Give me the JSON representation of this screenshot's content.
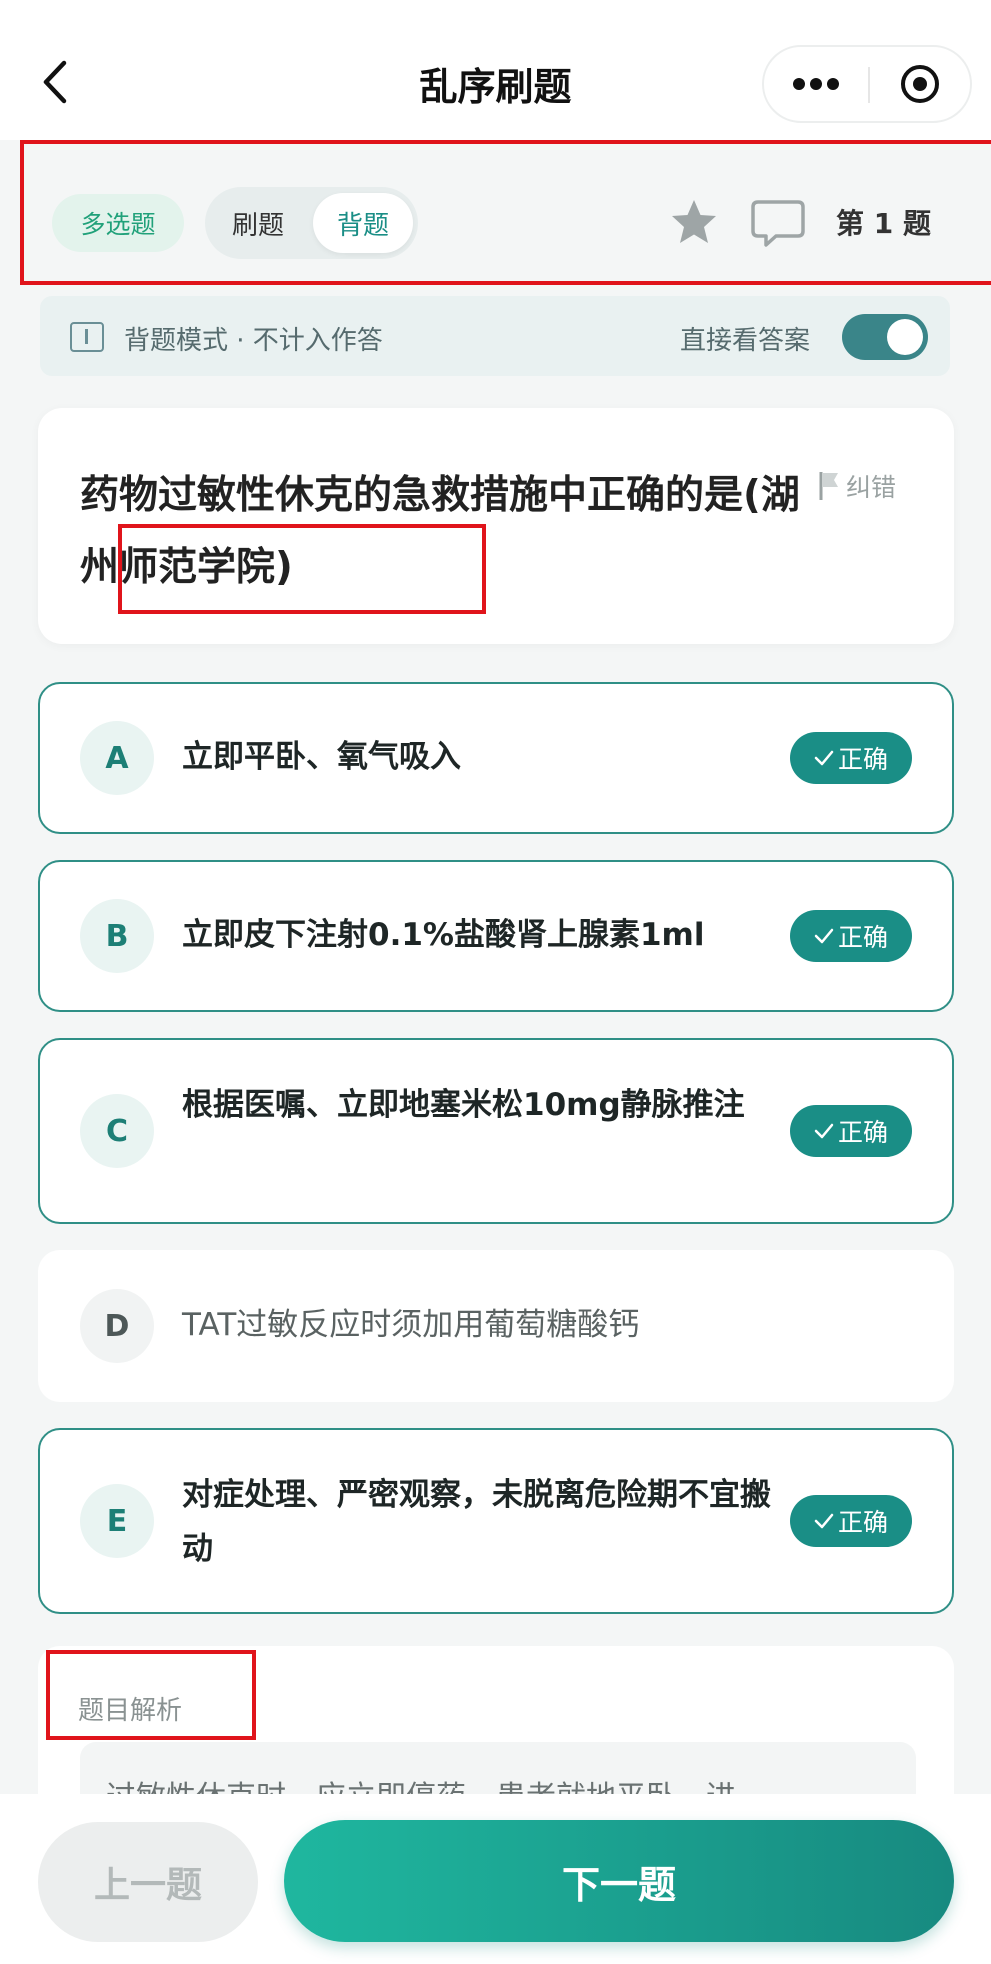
{
  "nav": {
    "title": "乱序刷题",
    "back_icon": "chevron-left-icon",
    "more_icon": "more-dots-icon",
    "target_icon": "target-icon"
  },
  "mode": {
    "type_badge": "多选题",
    "options": [
      "刷题",
      "背题"
    ],
    "selected": "背题",
    "question_number": "第 1 题"
  },
  "banner": {
    "text": "背题模式 · 不计入作答",
    "toggle_label": "直接看答案",
    "toggle_on": true
  },
  "question": {
    "text": "药物过敏性休克的急救措施中正确的是(湖州师范学院)",
    "report_label": "纠错"
  },
  "options": [
    {
      "letter": "A",
      "text": "立即平卧、氧气吸入",
      "correct": true,
      "badge": "正确"
    },
    {
      "letter": "B",
      "text": "立即皮下注射0.1%盐酸肾上腺素1ml",
      "correct": true,
      "badge": "正确"
    },
    {
      "letter": "C",
      "text": "根据医嘱、立即地塞米松10mg静脉推注",
      "correct": true,
      "badge": "正确"
    },
    {
      "letter": "D",
      "text": "TAT过敏反应时须加用葡萄糖酸钙",
      "correct": false,
      "badge": ""
    },
    {
      "letter": "E",
      "text": "对症处理、严密观察，未脱离危险期不宜搬动",
      "correct": true,
      "badge": "正确"
    }
  ],
  "analysis": {
    "label": "题目解析",
    "text": "过敏性休克时，应立即停药，患者就地平卧，进"
  },
  "footer": {
    "prev_label": "上一题",
    "next_label": "下一题"
  },
  "colors": {
    "accent": "#1a8e86",
    "annotation_red": "#e0141b",
    "badge_green": "#21a17a"
  }
}
